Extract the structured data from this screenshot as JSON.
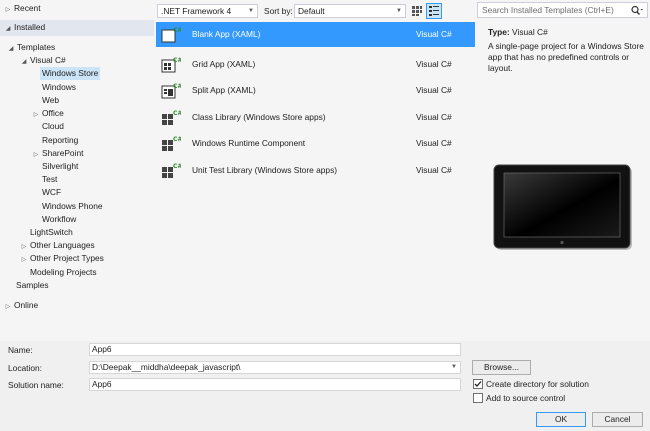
{
  "tree": {
    "recent": "Recent",
    "installed": "Installed",
    "templates": "Templates",
    "visual_csharp": "Visual C#",
    "windows_store": "Windows Store",
    "windows": "Windows",
    "web": "Web",
    "office": "Office",
    "cloud": "Cloud",
    "reporting": "Reporting",
    "sharepoint": "SharePoint",
    "silverlight": "Silverlight",
    "test": "Test",
    "wcf": "WCF",
    "windows_phone": "Windows Phone",
    "workflow": "Workflow",
    "lightswitch": "LightSwitch",
    "other_languages": "Other Languages",
    "other_project_types": "Other Project Types",
    "modeling_projects": "Modeling Projects",
    "samples": "Samples",
    "online": "Online"
  },
  "toolbar": {
    "framework": ".NET Framework 4",
    "sort_by_label": "Sort by:",
    "sort_value": "Default"
  },
  "search": {
    "placeholder": "Search Installed Templates (Ctrl+E)"
  },
  "templates": [
    {
      "name": "Blank App (XAML)",
      "lang": "Visual C#"
    },
    {
      "name": "Grid App (XAML)",
      "lang": "Visual C#"
    },
    {
      "name": "Split App (XAML)",
      "lang": "Visual C#"
    },
    {
      "name": "Class Library (Windows Store apps)",
      "lang": "Visual C#"
    },
    {
      "name": "Windows Runtime Component",
      "lang": "Visual C#"
    },
    {
      "name": "Unit Test Library (Windows Store apps)",
      "lang": "Visual C#"
    }
  ],
  "details": {
    "type_label": "Type:",
    "type_value": "Visual C#",
    "description": "A single-page project for a Windows Store app that has no predefined controls or layout."
  },
  "form": {
    "name_label": "Name:",
    "name_value": "App6",
    "location_label": "Location:",
    "location_value": "D:\\Deepak__middha\\deepak_javascript\\",
    "solution_label": "Solution name:",
    "solution_value": "App6",
    "browse": "Browse...",
    "create_dir": "Create directory for solution",
    "source_control": "Add to source control",
    "ok": "OK",
    "cancel": "Cancel"
  },
  "colors": {
    "selection": "#3399ff",
    "tree_bg": "#f5f5f5",
    "footer_bg": "#f0f0f0"
  }
}
